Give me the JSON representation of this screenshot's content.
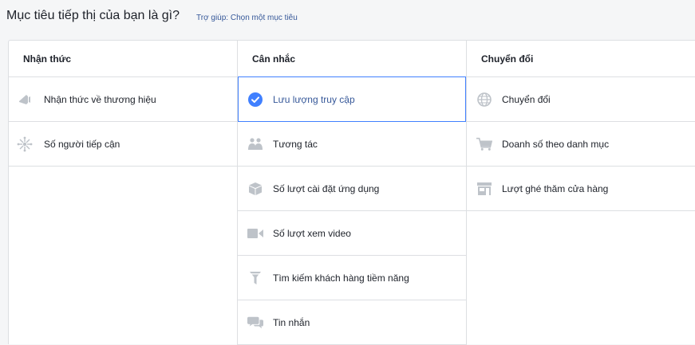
{
  "header": {
    "title": "Mục tiêu tiếp thị của bạn là gì?",
    "help_link": "Trợ giúp: Chọn một mục tiêu"
  },
  "columns": [
    {
      "heading": "Nhận thức",
      "items": [
        {
          "label": "Nhận thức về thương hiệu",
          "icon": "megaphone-icon"
        },
        {
          "label": "Số người tiếp cận",
          "icon": "reach-star-icon"
        }
      ]
    },
    {
      "heading": "Cân nhắc",
      "items": [
        {
          "label": "Lưu lượng truy cập",
          "icon": "check-circle-icon",
          "selected": true
        },
        {
          "label": "Tương tác",
          "icon": "people-icon"
        },
        {
          "label": "Số lượt cài đặt ứng dụng",
          "icon": "box-icon"
        },
        {
          "label": "Số lượt xem video",
          "icon": "video-camera-icon"
        },
        {
          "label": "Tìm kiếm khách hàng tiềm năng",
          "icon": "funnel-icon"
        },
        {
          "label": "Tin nhắn",
          "icon": "chat-bubbles-icon"
        }
      ]
    },
    {
      "heading": "Chuyển đổi",
      "items": [
        {
          "label": "Chuyển đổi",
          "icon": "globe-icon"
        },
        {
          "label": "Doanh số theo danh mục",
          "icon": "cart-icon"
        },
        {
          "label": "Lượt ghé thăm cửa hàng",
          "icon": "store-icon"
        }
      ]
    }
  ],
  "colors": {
    "accent": "#4080ff",
    "link": "#365899",
    "icon_gray": "#bec3c9",
    "border": "#dddfe2"
  }
}
